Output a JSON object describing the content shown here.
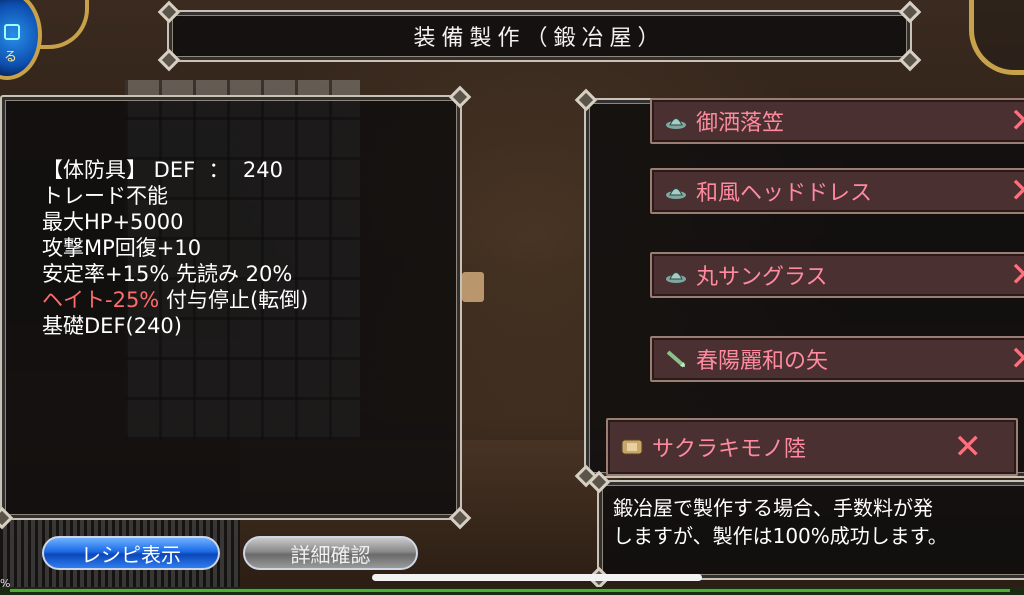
{
  "header": {
    "title": "装備製作（鍛冶屋）"
  },
  "back_button": {
    "label": "る"
  },
  "info": {
    "lines": [
      {
        "text": "【体防具】 DEF  ：  240"
      },
      {
        "text": "トレード不能"
      },
      {
        "text": "最大HP+5000"
      },
      {
        "text": "攻撃MP回復+10"
      },
      {
        "text": "安定率+15% 先読み 20%"
      }
    ],
    "hate": "ヘイト-25%",
    "hate_suffix": " 付与停止(転倒)",
    "base": "基礎DEF(240)"
  },
  "buttons": {
    "recipe": "レシピ表示",
    "details": "詳細確認"
  },
  "recipe_items": [
    {
      "name": "御洒落笠",
      "icon": "hat-icon",
      "remove": "✕"
    },
    {
      "name": "和風ヘッドドレス",
      "icon": "hat-icon",
      "remove": "✕"
    },
    {
      "name": "丸サングラス",
      "icon": "hat-icon",
      "remove": "✕"
    },
    {
      "name": "春陽麗和の矢",
      "icon": "arrow-icon",
      "remove": "✕"
    },
    {
      "name": "サクラキモノ陸",
      "icon": "armor-icon",
      "remove": "✕"
    }
  ],
  "description": {
    "line1": "鍛冶屋で製作する場合、手数料が発",
    "line2": "しますが、製作は100%成功します。"
  },
  "status": {
    "percent": "%"
  },
  "colors": {
    "item_text": "#ff8aa0",
    "remove": "#ff6f7d",
    "hate": "#ff6a6a",
    "recipe_button": "#1c6be6"
  }
}
